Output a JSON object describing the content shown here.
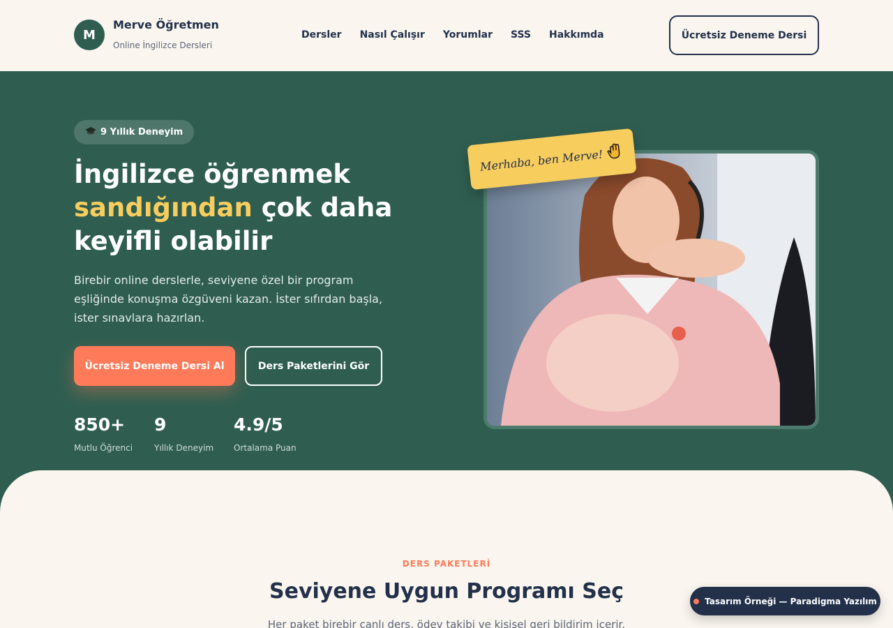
{
  "header": {
    "logo_letter": "M",
    "brand_name": "Merve Öğretmen",
    "brand_sub": "Online İngilizce Dersleri",
    "nav": [
      "Dersler",
      "Nasıl Çalışır",
      "Yorumlar",
      "SSS",
      "Hakkımda"
    ],
    "cta": "Ücretsiz Deneme Dersi"
  },
  "hero": {
    "badge_icon": "graduation-cap-icon",
    "badge": "9 Yıllık Deneyim",
    "title_line1": "İngilizce öğrenmek",
    "title_highlight": "sandığından",
    "title_rest": " çok daha",
    "title_line3": "keyifli olabilir",
    "description": "Birebir online derslerle, seviyene özel bir program eşliğinde konuşma özgüveni kazan. İster sıfırdan başla, ister sınavlara hazırlan.",
    "primary_button": "Ücretsiz Deneme Dersi Al",
    "secondary_button": "Ders Paketlerini Gör",
    "stats": [
      {
        "value": "850+",
        "label": "Mutlu Öğrenci"
      },
      {
        "value": "9",
        "label": "Yıllık Deneyim"
      },
      {
        "value": "4.9/5",
        "label": "Ortalama Puan"
      }
    ],
    "photo_tag": "Merhaba, ben Merve!",
    "photo_tag_icon": "waving-hand-icon"
  },
  "section": {
    "kicker": "DERS PAKETLERİ",
    "title": "Seviyene Uygun Programı Seç",
    "description": "Her paket birebir canlı ders, ödev takibi ve kişisel geri bildirim içerir."
  },
  "float_badge": "Tasarım Örneği — Paradigma Yazılım",
  "colors": {
    "primary_green": "#2f5e50",
    "accent_orange": "#ff7a59",
    "highlight_yellow": "#f7cd5e",
    "navy": "#22304a",
    "cream": "#faf6ef"
  }
}
